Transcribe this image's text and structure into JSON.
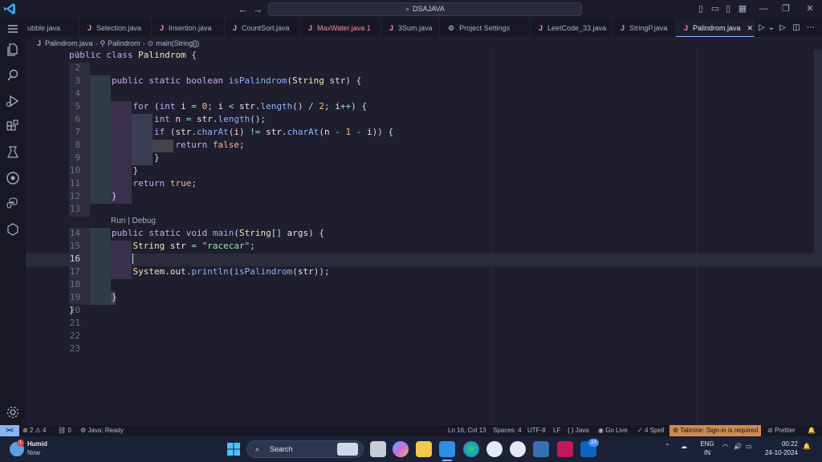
{
  "titlebar": {
    "search_text": "DSAJAVA",
    "back_label": "←",
    "forward_label": "→"
  },
  "tabs": [
    {
      "label": "ubble.java",
      "modified": false
    },
    {
      "label": "Selection.java",
      "modified": false
    },
    {
      "label": "Insertion.java",
      "modified": false
    },
    {
      "label": "CountSort.java",
      "modified": false
    },
    {
      "label": "MaxWater.java 1",
      "modified": true
    },
    {
      "label": "3Sum.java",
      "modified": false
    },
    {
      "label": "Project Settings",
      "modified": false
    },
    {
      "label": "LeetCode_33.java",
      "modified": false
    },
    {
      "label": "StringP.java",
      "modified": false
    },
    {
      "label": "Palindrom.java",
      "modified": false,
      "active": true
    }
  ],
  "breadcrumb": {
    "file": "Palindrom.java",
    "cls": "Palindrom",
    "method": "main(String[])"
  },
  "editor": {
    "codelens": "Run | Debug",
    "line_numbers": [
      "1",
      "2",
      "3",
      "4",
      "5",
      "6",
      "7",
      "8",
      "9",
      "10",
      "11",
      "12",
      "13",
      "14",
      "15",
      "16",
      "17",
      "18",
      "19",
      "20",
      "21",
      "22",
      "23"
    ],
    "current_line": 16
  },
  "statusbar": {
    "remote_icon": "><",
    "errors": "⊗ 2 ⚠ 4",
    "ports": "⛓ 0",
    "java": "Java: Ready",
    "position": "Ln 16, Col 13",
    "spaces": "Spaces: 4",
    "encoding": "UTF-8",
    "eol": "LF",
    "language": "{ } Java",
    "golive": "Go Live",
    "spell": "4 Spell",
    "tabnine": "Tabnine: Sign-in is required",
    "prettier": "Prettier"
  },
  "taskbar": {
    "weather_title": "Humid",
    "weather_sub": "Now",
    "search_label": "Search",
    "lang_top": "ENG",
    "lang_bottom": "IN",
    "time": "00:22",
    "date": "24-10-2024",
    "notif_badge": "24"
  },
  "colors": {
    "accent": "#89b4fa",
    "tabnine": "#d08a4f",
    "keyword": "#cba6f7",
    "type": "#f9e2af",
    "function": "#89b4fa",
    "string": "#a6e3a1"
  }
}
